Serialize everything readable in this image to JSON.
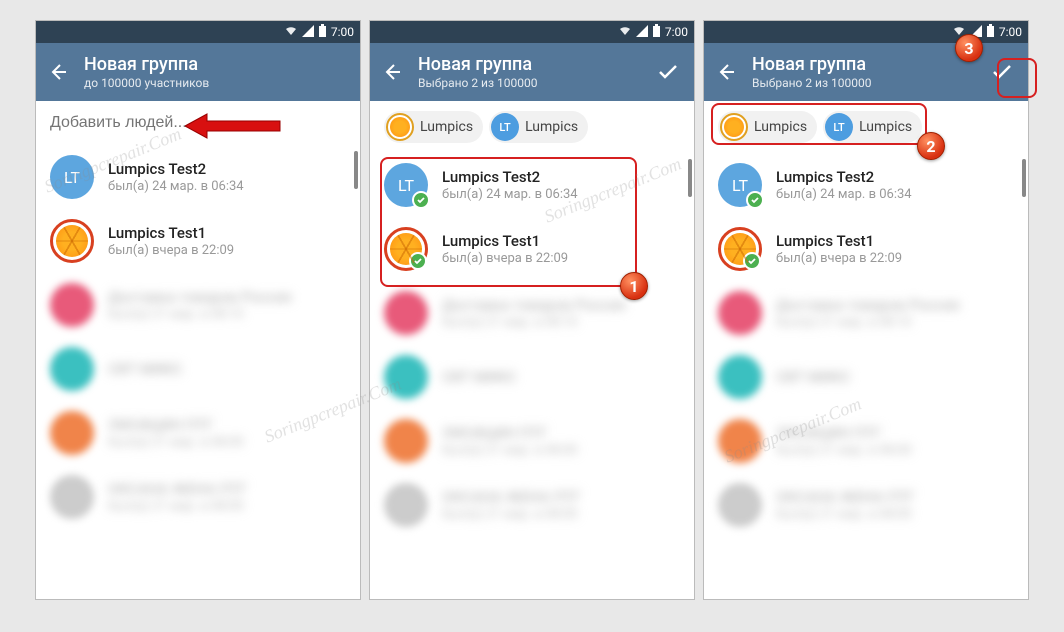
{
  "status": {
    "time": "7:00"
  },
  "header": {
    "title": "Новая группа",
    "subtitle_initial": "до 100000 участников",
    "subtitle_selected": "Выбрано 2 из 100000"
  },
  "search": {
    "placeholder": "Добавить людей..."
  },
  "chips": [
    {
      "label": "Lumpics",
      "avatar_type": "orange",
      "avatar_text": ""
    },
    {
      "label": "Lumpics",
      "avatar_type": "blue",
      "avatar_text": "LT"
    }
  ],
  "contacts": [
    {
      "name": "Lumpics Test2",
      "status": "был(а) 24 мар. в 06:34",
      "avatar_type": "blue",
      "avatar_text": "LT"
    },
    {
      "name": "Lumpics Test1",
      "status": "был(а) вчера в 22:09",
      "avatar_type": "orange",
      "avatar_text": ""
    }
  ],
  "blurred_contacts": [
    {
      "name": "Доставка товаров Россия",
      "status": "был(а) 21 мар. в 08:10",
      "avatar_class": "av-pink"
    },
    {
      "name": "СВТ МИКС",
      "status": "",
      "avatar_class": "av-cyan"
    },
    {
      "name": "ЛИСИЦИН ПТГ",
      "status": "был(а) 21 мар. в 08:00",
      "avatar_class": "av-orange2"
    },
    {
      "name": "ОКСАНА ЖЕНА ПТГ",
      "status": "был(а) 21 мар. в 08:00",
      "avatar_class": "av-grey"
    }
  ],
  "steps": {
    "1": "1",
    "2": "2",
    "3": "3"
  },
  "watermark": "Soringpcrepair.Com"
}
